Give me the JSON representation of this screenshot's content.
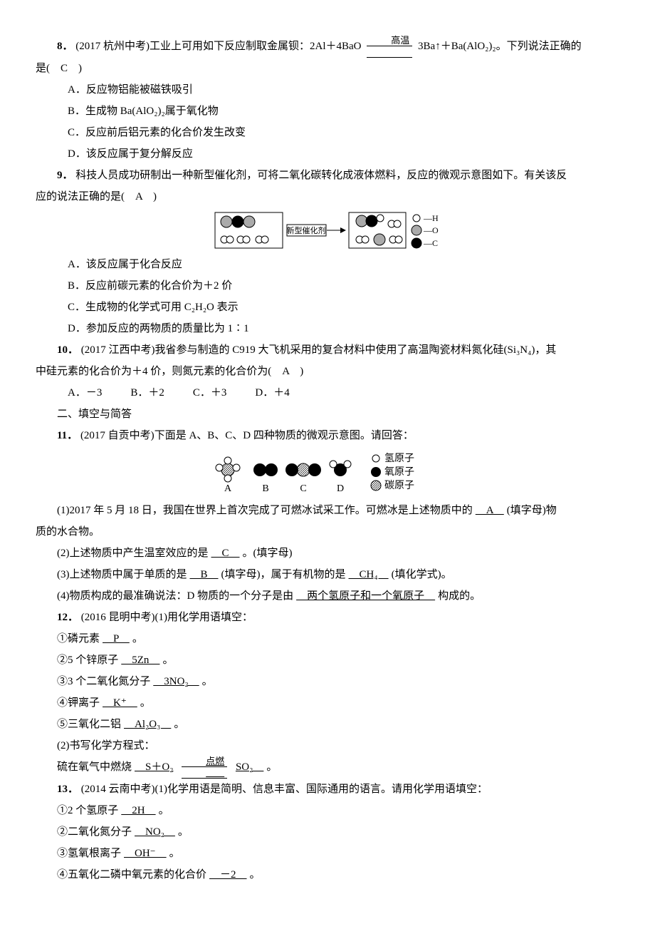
{
  "q8": {
    "num": "8．",
    "source": "(2017 杭州中考)",
    "stem1": "工业上可用如下反应制取金属钡：2Al＋4BaO",
    "cond": "高温",
    "stem2": " 3Ba↑＋Ba(AlO₂)₂。下列说法正确的",
    "stem3": "是(　C　)",
    "optA": "A．反应物铝能被磁铁吸引",
    "optB": "B．生成物 Ba(AlO₂)₂属于氧化物",
    "optC": "C．反应前后铝元素的化合价发生改变",
    "optD": "D．该反应属于复分解反应"
  },
  "q9": {
    "num": "9．",
    "stem1": "科技人员成功研制出一种新型催化剂，可将二氧化碳转化成液体燃料，反应的微观示意图如下。有关该反",
    "stem2": "应的说法正确的是(　A　)",
    "diagram_label": "新型催化剂",
    "legend": {
      "H": "—H",
      "O": "—O",
      "C": "—C"
    },
    "optA": "A．该反应属于化合反应",
    "optB": "B．反应前碳元素的化合价为＋2 价",
    "optC": "C．生成物的化学式可用 C₂H₂O 表示",
    "optD": "D．参加反应的两物质的质量比为 1∶1"
  },
  "q10": {
    "num": "10．",
    "source": "(2017 江西中考)",
    "stem1": "我省参与制造的 C919 大飞机采用的复合材料中使用了高温陶瓷材料氮化硅(Si₃N₄)，其",
    "stem2": "中硅元素的化合价为＋4 价，则氮元素的化合价为(　A　)",
    "A": "A．－3",
    "B": "B．＋2",
    "C": "C．＋3",
    "D": "D．＋4"
  },
  "section2": "二、填空与简答",
  "q11": {
    "num": "11．",
    "source": "(2017 自贡中考)",
    "stem": "下面是 A、B、C、D 四种物质的微观示意图。请回答：",
    "labels": {
      "A": "A",
      "B": "B",
      "C": "C",
      "D": "D"
    },
    "legend": {
      "h": "氢原子",
      "o": "氧原子",
      "c": "碳原子"
    },
    "p1a": "(1)2017 年 5 月 18 日，我国在世界上首次完成了可燃冰试采工作。可燃冰是上述物质中的",
    "p1ans": "　A　",
    "p1b": "(填字母)物",
    "p1c": "质的水合物。",
    "p2a": "(2)上述物质中产生温室效应的是",
    "p2ans": "　C　",
    "p2b": "。(填字母)",
    "p3a": "(3)上述物质中属于单质的是",
    "p3ans1": "　B　",
    "p3b": "(填字母)，属于有机物的是",
    "p3ans2": "　CH₄　",
    "p3c": "(填化学式)。",
    "p4a": "(4)物质构成的最准确说法：D 物质的一个分子是由",
    "p4ans": "　两个氢原子和一个氧原子　",
    "p4b": "构成的。"
  },
  "q12": {
    "num": "12．",
    "source": "(2016 昆明中考)",
    "stem": "(1)用化学用语填空：",
    "l1a": "①磷元素",
    "l1ans": "　P　",
    "l1b": "。",
    "l2a": "②5 个锌原子",
    "l2ans": "　5Zn　",
    "l2b": "。",
    "l3a": "③3 个二氧化氮分子",
    "l3ans": "　3NO₂　",
    "l3b": "。",
    "l4a": "④钾离子",
    "l4ans": "　K⁺　",
    "l4b": "。",
    "l5a": "⑤三氧化二铝",
    "l5ans": "　Al₂O₃　",
    "l5b": "。",
    "p2": "(2)书写化学方程式：",
    "eq_a": "硫在氧气中燃烧",
    "eq_lhs": "　S＋O₂",
    "eq_cond": "点燃",
    "eq_rhs": "SO₂　",
    "eq_b": "。"
  },
  "q13": {
    "num": "13．",
    "source": "(2014 云南中考)",
    "stem": "(1)化学用语是简明、信息丰富、国际通用的语言。请用化学用语填空：",
    "l1a": "①2 个氢原子",
    "l1ans": "　2H　",
    "l1b": "。",
    "l2a": "②二氧化氮分子",
    "l2ans": "　NO₂　",
    "l2b": "。",
    "l3a": "③氢氧根离子",
    "l3ans": "　OH⁻　",
    "l3b": "。",
    "l4a": "④五氧化二磷中氧元素的化合价",
    "l4ans": "　－2　",
    "l4b": "。"
  }
}
